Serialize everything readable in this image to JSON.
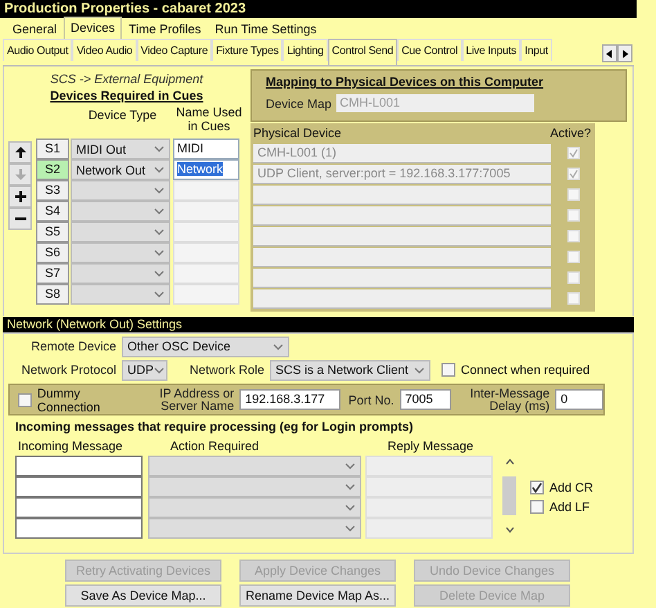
{
  "window": {
    "title": "Production Properties - cabaret 2023"
  },
  "tabs": [
    {
      "label": "General",
      "selected": false
    },
    {
      "label": "Devices",
      "selected": true
    },
    {
      "label": "Time Profiles",
      "selected": false
    },
    {
      "label": "Run Time Settings",
      "selected": false
    }
  ],
  "subtabs": [
    {
      "label": "Audio Output",
      "selected": false
    },
    {
      "label": "Video Audio",
      "selected": false
    },
    {
      "label": "Video Capture",
      "selected": false
    },
    {
      "label": "Fixture Types",
      "selected": false
    },
    {
      "label": "Lighting",
      "selected": false
    },
    {
      "label": "Control Send",
      "selected": true
    },
    {
      "label": "Cue Control",
      "selected": false
    },
    {
      "label": "Live Inputs",
      "selected": false
    },
    {
      "label": "Input",
      "selected": false
    }
  ],
  "devices_panel": {
    "caption": "SCS -> External Equipment",
    "heading": "Devices Required in Cues",
    "columns": [
      "Device Type",
      "Name Used in Cues"
    ],
    "tools": [
      {
        "kind": "up",
        "disabled": false
      },
      {
        "kind": "down",
        "disabled": true
      },
      {
        "kind": "add",
        "disabled": false
      },
      {
        "kind": "remove",
        "disabled": false
      }
    ],
    "rows": [
      {
        "slot": "S1",
        "type": "MIDI Out",
        "name": "MIDI",
        "selected": false
      },
      {
        "slot": "S2",
        "type": "Network Out",
        "name": "Network",
        "selected": true
      },
      {
        "slot": "S3",
        "selected": false
      },
      {
        "slot": "S4",
        "selected": false
      },
      {
        "slot": "S5",
        "selected": false
      },
      {
        "slot": "S6",
        "selected": false
      },
      {
        "slot": "S7",
        "selected": false
      },
      {
        "slot": "S8",
        "selected": false
      }
    ]
  },
  "mapping": {
    "heading": "Mapping to Physical Devices on this Computer",
    "device_map_label": "Device Map",
    "device_map": "CMH-L001",
    "columns": [
      "Physical Device",
      "Active?"
    ],
    "rows": [
      {
        "device": "CMH-L001 (1)",
        "active": true
      },
      {
        "device": "UDP Client, server:port = 192.168.3.177:7005",
        "active": true
      },
      {
        "active": false
      },
      {
        "active": false
      },
      {
        "active": false
      },
      {
        "active": false
      },
      {
        "active": false
      },
      {
        "active": false
      }
    ]
  },
  "network": {
    "heading": "Network (Network Out) Settings",
    "remote_device_label": "Remote Device",
    "remote_device": "Other OSC Device",
    "protocol_label": "Network Protocol",
    "protocol": "UDP",
    "role_label": "Network Role",
    "role": "SCS is a Network Client",
    "connect_when_required": {
      "label": "Connect when required",
      "checked": false
    },
    "dummy_connection": {
      "label": "Dummy Connection",
      "checked": false
    },
    "ip_label": "IP Address or Server Name",
    "ip": "192.168.3.177",
    "port_label": "Port No.",
    "port": "7005",
    "delay_label": "Inter-Message Delay (ms)",
    "delay": "0",
    "incoming_heading": "Incoming messages that require processing (eg for Login prompts)",
    "incoming_columns": [
      "Incoming Message",
      "Action Required",
      "Reply Message"
    ],
    "incoming_rows": [
      {
        "kind": "blank"
      },
      {
        "kind": "blank"
      },
      {
        "kind": "blank"
      },
      {
        "kind": "blank"
      }
    ],
    "add_cr": {
      "label": "Add CR",
      "checked": true
    },
    "add_lf": {
      "label": "Add LF",
      "checked": false
    }
  },
  "buttons": [
    {
      "label": "Retry Activating Devices",
      "disabled": true
    },
    {
      "label": "Apply Device Changes",
      "disabled": true
    },
    {
      "label": "Undo Device Changes",
      "disabled": true
    },
    {
      "label": "Save As Device Map...",
      "disabled": false
    },
    {
      "label": "Rename Device Map As...",
      "disabled": false
    },
    {
      "label": "Delete Device Map",
      "disabled": true
    }
  ]
}
